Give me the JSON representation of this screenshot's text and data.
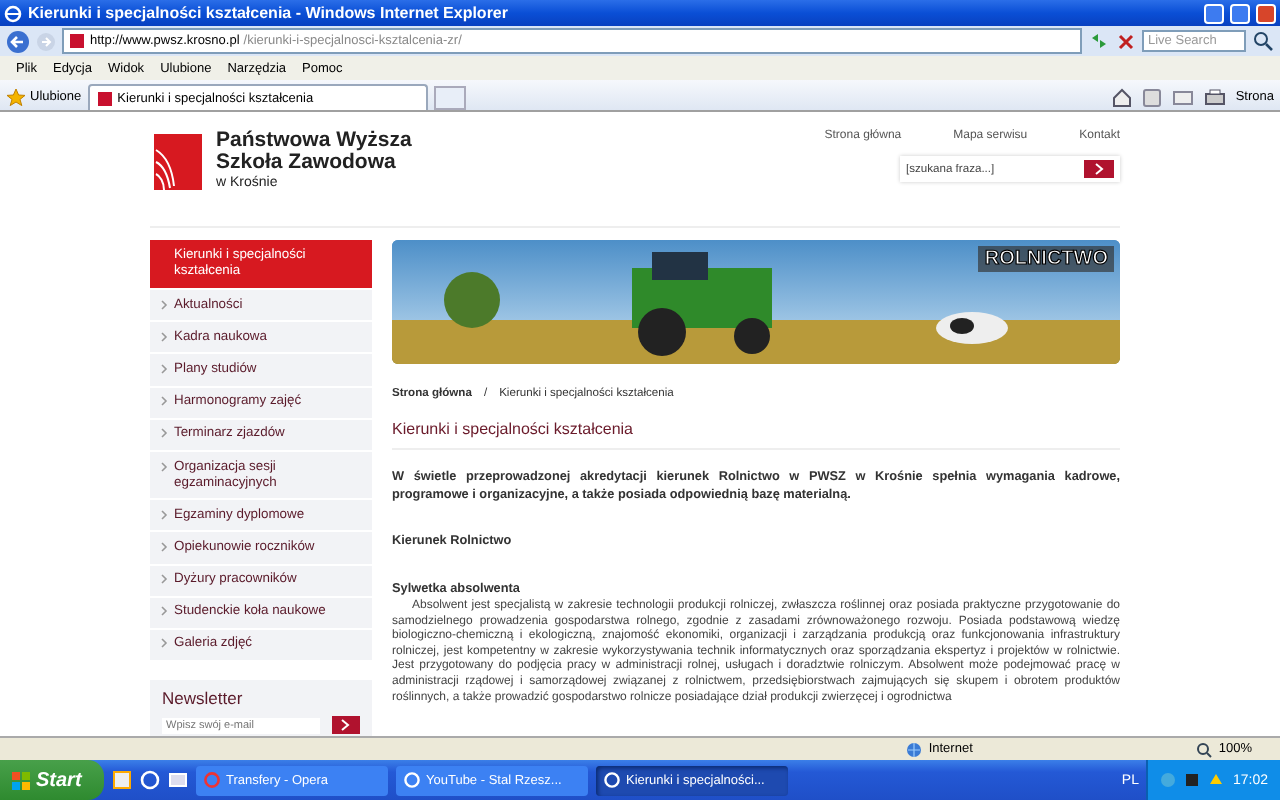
{
  "window": {
    "title": "Kierunki i specjalności kształcenia - Windows Internet Explorer"
  },
  "address_bar": {
    "url_host": "http://www.pwsz.krosno.pl",
    "url_path": "/kierunki-i-specjalnosci-ksztalcenia-zr/",
    "search_placeholder": "Live Search"
  },
  "menu_bar": [
    "Plik",
    "Edycja",
    "Widok",
    "Ulubione",
    "Narzędzia",
    "Pomoc"
  ],
  "favorites_bar": {
    "favorites": "Ulubione",
    "tabs": [
      {
        "label": "Kierunki i specjalności kształcenia",
        "selected": true
      }
    ],
    "page_menu": "Strona"
  },
  "site": {
    "logo": [
      "Państwowa Wyższa",
      "Szkoła Zawodowa",
      "w Krośnie"
    ],
    "top_links": [
      "Strona główna",
      "Mapa serwisu",
      "Kontakt"
    ],
    "search": {
      "placeholder": "[szukana fraza...]"
    },
    "sidebar": {
      "items": [
        {
          "label": "Kierunki i specjalności kształcenia",
          "selected": true
        },
        {
          "label": "Aktualności",
          "selected": false
        },
        {
          "label": "Kadra naukowa",
          "selected": false
        },
        {
          "label": "Plany studiów",
          "selected": false
        },
        {
          "label": "Harmonogramy zajęć",
          "selected": false
        },
        {
          "label": "Terminarz zjazdów",
          "selected": false
        },
        {
          "label": "Organizacja sesji egzaminacyjnych",
          "selected": false
        },
        {
          "label": "Egzaminy dyplomowe",
          "selected": false
        },
        {
          "label": "Opiekunowie roczników",
          "selected": false
        },
        {
          "label": "Dyżury pracowników",
          "selected": false
        },
        {
          "label": "Studenckie koła naukowe",
          "selected": false
        },
        {
          "label": "Galeria zdjęć",
          "selected": false
        }
      ]
    },
    "newsletter": {
      "title": "Newsletter",
      "placeholder": "Wpisz swój e-mail"
    },
    "banner": {
      "label": "ROLNICTWO"
    },
    "breadcrumb": [
      "Strona główna",
      "Kierunki i specjalności kształcenia"
    ],
    "breadcrumb_separator": "/",
    "heading": "Kierunki i specjalności kształcenia",
    "intro": "W świetle przeprowadzonej akredytacji kierunek Rolnictwo w PWSZ w Krośnie spełnia wymagania kadrowe, programowe i organizacyjne, a także posiada odpowiednią bazę materialną.",
    "subheading": "Kierunek Rolnictwo",
    "section_title": "Sylwetka absolwenta",
    "paragraph": "Absolwent jest specjalistą w zakresie technologii produkcji rolniczej, zwłaszcza roślinnej oraz posiada praktyczne przygotowanie do samodzielnego prowadzenia gospodarstwa rolnego, zgodnie z zasadami zrównoważonego rozwoju. Posiada podstawową wiedzę biologiczno-chemiczną i ekologiczną, znajomość ekonomiki, organizacji i zarządzania produkcją oraz funkcjonowania infrastruktury rolniczej, jest kompetentny w zakresie wykorzystywania technik informatycznych oraz sporządzania ekspertyz i projektów w rolnictwie. Jest przygotowany do podjęcia pracy w administracji rolnej, usługach i doradztwie rolniczym. Absolwent może podejmować pracę w administracji rządowej i samorządowej związanej z rolnictwem, przedsiębiorstwach zajmujących się skupem i obrotem produktów roślinnych, a także prowadzić gospodarstwo rolnicze posiadające dział produkcji zwierzęcej i ogrodnictwa"
  },
  "status_bar": {
    "zone": "Internet",
    "zoom": "100%"
  },
  "taskbar": {
    "start": "Start",
    "tasks": [
      {
        "label": "Transfery - Opera",
        "selected": false
      },
      {
        "label": "YouTube - Stal Rzesz...",
        "selected": false
      },
      {
        "label": "Kierunki i specjalności...",
        "selected": true
      }
    ],
    "language": "PL",
    "clock": "17:02"
  }
}
